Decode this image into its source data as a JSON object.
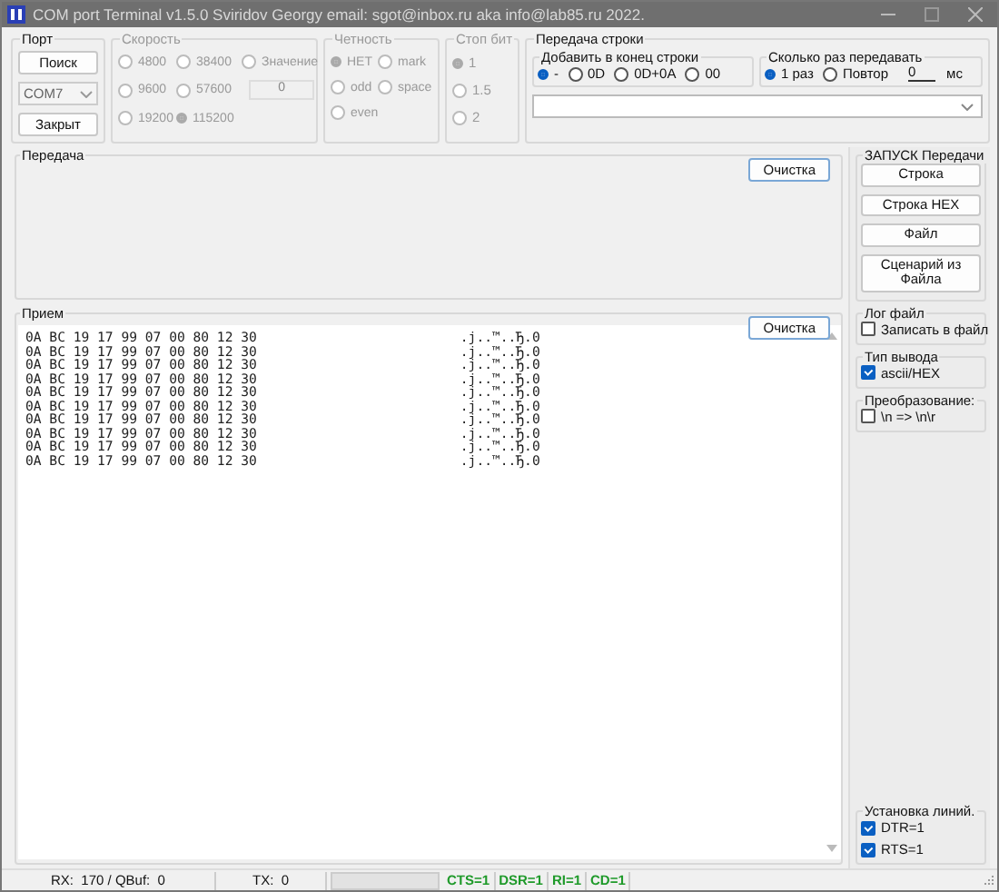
{
  "window": {
    "title": "COM port Terminal v1.5.0  Sviridov Georgy email: sgot@inbox.ru aka info@lab85.ru 2022."
  },
  "port": {
    "label": "Порт",
    "search_button": "Поиск",
    "port_select": {
      "value": "COM7",
      "disabled": true
    },
    "close_button": "Закрыт"
  },
  "speed": {
    "label": "Скорость",
    "disabled": true,
    "options": [
      {
        "kind": "radio",
        "label": "4800",
        "selected": false
      },
      {
        "kind": "radio",
        "label": "38400",
        "selected": false
      },
      {
        "kind": "radio",
        "label": "Значение",
        "selected": false
      },
      {
        "kind": "radio",
        "label": "9600",
        "selected": false
      },
      {
        "kind": "radio",
        "label": "57600",
        "selected": false
      },
      {
        "kind": "field",
        "value": "0"
      },
      {
        "kind": "radio",
        "label": "19200",
        "selected": false
      },
      {
        "kind": "radio",
        "label": "115200",
        "selected": true
      }
    ]
  },
  "parity": {
    "label": "Четность",
    "disabled": true,
    "options": [
      {
        "label": "НЕТ",
        "selected": true
      },
      {
        "label": "mark",
        "selected": false
      },
      {
        "label": "odd",
        "selected": false
      },
      {
        "label": "space",
        "selected": false
      },
      {
        "label": "even",
        "selected": false
      }
    ]
  },
  "stop_bits": {
    "label": "Стоп бит",
    "disabled": true,
    "options": [
      {
        "label": "1",
        "selected": true
      },
      {
        "label": "1.5",
        "selected": false
      },
      {
        "label": "2",
        "selected": false
      }
    ]
  },
  "line_send": {
    "label": "Передача строки",
    "append": {
      "label": "Добавить в конец строки",
      "options": [
        {
          "label": "-",
          "selected": true
        },
        {
          "label": "0D",
          "selected": false
        },
        {
          "label": "0D+0A",
          "selected": false
        },
        {
          "label": "00",
          "selected": false
        }
      ]
    },
    "repeat": {
      "label": "Сколько раз передавать",
      "options": [
        {
          "label": "1 раз",
          "selected": true
        },
        {
          "label": "Повтор",
          "selected": false
        }
      ],
      "interval": "0",
      "unit": "мс"
    }
  },
  "transmit": {
    "label": "Передача",
    "clear_button": "Очистка"
  },
  "receive": {
    "label": "Прием",
    "clear_button": "Очистка",
    "lines": [
      {
        "hex": "0A BC 19 17 99 07 00 80 12 30",
        "ascii": ".ј..™..Ђ.0"
      },
      {
        "hex": "0A BC 19 17 99 07 00 80 12 30",
        "ascii": ".ј..™..Ђ.0"
      },
      {
        "hex": "0A BC 19 17 99 07 00 80 12 30",
        "ascii": ".ј..™..Ђ.0"
      },
      {
        "hex": "0A BC 19 17 99 07 00 80 12 30",
        "ascii": ".ј..™..Ђ.0"
      },
      {
        "hex": "0A BC 19 17 99 07 00 80 12 30",
        "ascii": ".ј..™..Ђ.0"
      },
      {
        "hex": "0A BC 19 17 99 07 00 80 12 30",
        "ascii": ".ј..™..Ђ.0"
      },
      {
        "hex": "0A BC 19 17 99 07 00 80 12 30",
        "ascii": ".ј..™..Ђ.0"
      },
      {
        "hex": "0A BC 19 17 99 07 00 80 12 30",
        "ascii": ".ј..™..Ђ.0"
      },
      {
        "hex": "0A BC 19 17 99 07 00 80 12 30",
        "ascii": ".ј..™..Ђ.0"
      },
      {
        "hex": "0A BC 19 17 99 07 00 80 12 30",
        "ascii": ".ј..™..Ђ.0"
      }
    ]
  },
  "run": {
    "label": "ЗАПУСК Передачи",
    "buttons": [
      "Строка",
      "Строка HEX",
      "Файл",
      "Сценарий из Файла"
    ]
  },
  "log_file": {
    "label": "Лог файл",
    "checkbox": {
      "label": "Записать в файл",
      "checked": false
    }
  },
  "output_type": {
    "label": "Тип вывода",
    "checkbox": {
      "label": "ascii/HEX",
      "checked": true
    }
  },
  "transform": {
    "label": "Преобразование:",
    "checkbox": {
      "label": "\\n => \\n\\r",
      "checked": false
    }
  },
  "lines": {
    "label": "Установка линий.",
    "checkboxes": [
      {
        "label": "DTR=1",
        "checked": true
      },
      {
        "label": "RTS=1",
        "checked": true
      }
    ]
  },
  "status_bar": {
    "rx": "RX:  170 / QBuf:  0",
    "tx": "TX:  0",
    "progress": {
      "level": 0
    },
    "signals": [
      "CTS=1",
      "DSR=1",
      "RI=1",
      "CD=1"
    ]
  }
}
